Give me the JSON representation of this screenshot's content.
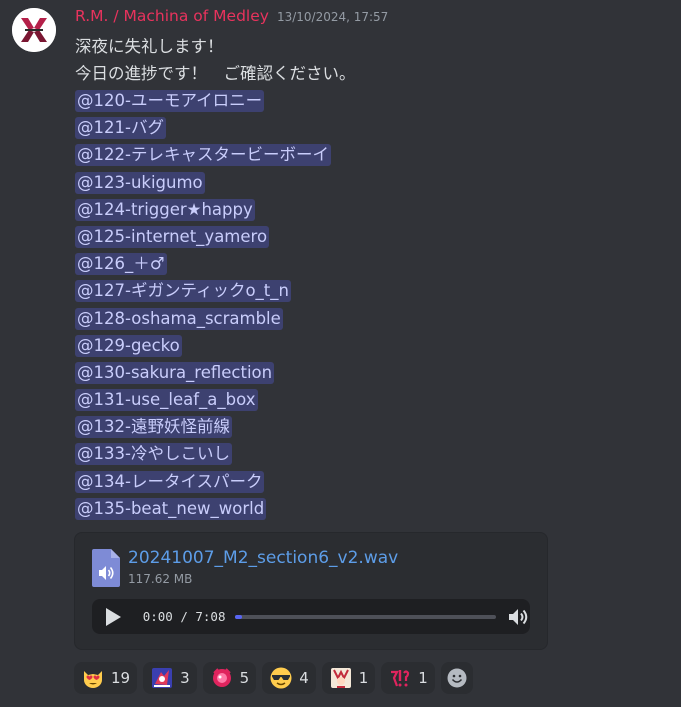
{
  "message": {
    "username": "R.M. / Machina of Medley",
    "timestamp": "13/10/2024, 17:57",
    "lines": [
      "深夜に失礼します！",
      "今日の進捗です！　ご確認ください。"
    ],
    "mentions": [
      "@120-ユーモアイロニー",
      "@121-バグ",
      "@122-テレキャスタービーボーイ",
      "@123-ukigumo",
      "@124-trigger★happy",
      "@125-internet_yamero",
      "@126_＋♂",
      "@127-ギガンティックo_t_n",
      "@128-oshama_scramble",
      "@129-gecko",
      "@130-sakura_reflection",
      "@131-use_leaf_a_box",
      "@132-遠野妖怪前線",
      "@133-冷やしこいし",
      "@134-レータイスパーク",
      "@135-beat_new_world"
    ]
  },
  "attachment": {
    "filename": "20241007_M2_section6_v2.wav",
    "size": "117.62 MB",
    "time": "0:00 / 7:08",
    "progress": 0.03
  },
  "reactions": [
    {
      "icon": "heart-eyes-cat-emoji",
      "count": "19"
    },
    {
      "icon": "custom-character-emoji",
      "count": "3"
    },
    {
      "icon": "custom-pink-emoji",
      "count": "5"
    },
    {
      "icon": "sunglasses-emoji",
      "count": "4"
    },
    {
      "icon": "custom-character-emoji-2",
      "count": "1"
    },
    {
      "icon": "custom-text-emoji",
      "count": "1"
    }
  ],
  "colors": {
    "background": "#313338",
    "username": "#e8335d",
    "mention_bg": "#3c4270",
    "link": "#5d9de8",
    "accent": "#5865f2"
  }
}
